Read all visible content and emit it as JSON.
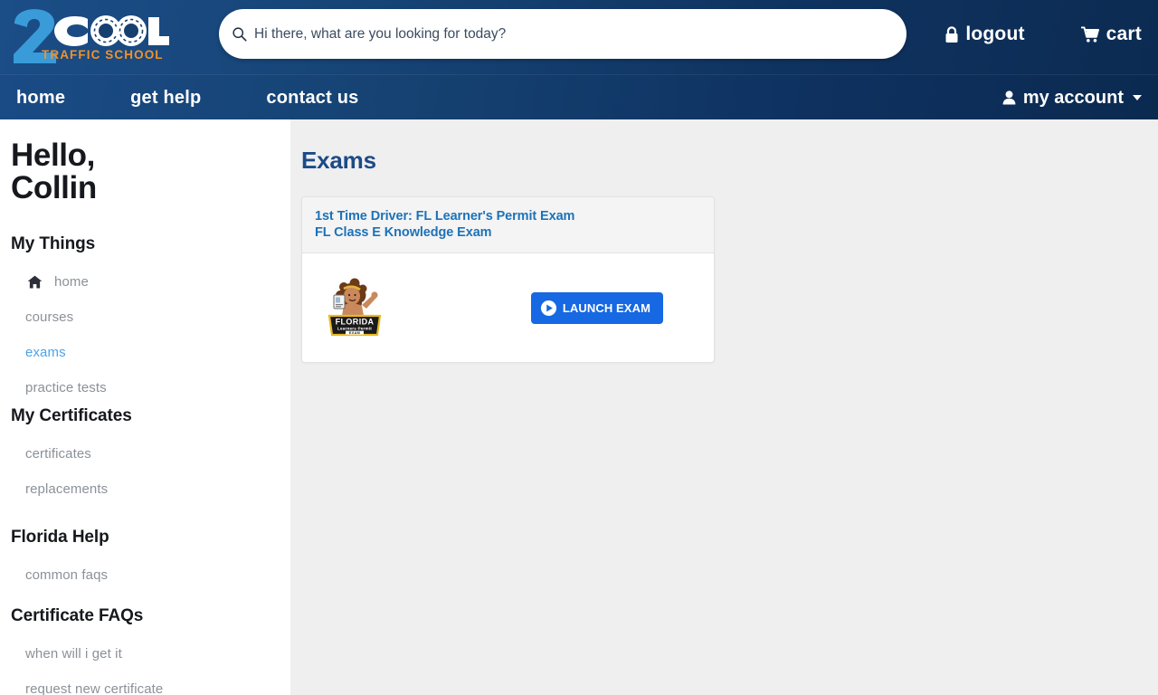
{
  "brand": {
    "logo_digit": "2",
    "logo_word": "COOL",
    "logo_tagline": "TRAFFIC SCHOOL",
    "blue": "#3a9bd9",
    "orange": "#f0922b",
    "navy": "#103360"
  },
  "header": {
    "search": {
      "placeholder": "Hi there, what are you looking for today?",
      "value": "",
      "icon": "search-icon"
    },
    "links": [
      {
        "label": "logout",
        "icon": "lock-icon"
      },
      {
        "label": "cart",
        "icon": "shopping-cart-icon"
      }
    ]
  },
  "nav": {
    "items": [
      {
        "label": "home"
      },
      {
        "label": "get help"
      },
      {
        "label": "contact us"
      }
    ],
    "account": {
      "label": "my account",
      "icon": "user-icon",
      "caret": "chevron-down-icon"
    }
  },
  "sidebar": {
    "greeting_line1": "Hello,",
    "greeting_line2": "Collin",
    "sections": [
      {
        "title": "My Things",
        "items": [
          {
            "label": "home",
            "icon": "house-icon",
            "active": false
          },
          {
            "label": "courses",
            "icon": "",
            "active": false
          },
          {
            "label": "exams",
            "icon": "",
            "active": true
          },
          {
            "label": "practice tests",
            "icon": "",
            "active": false
          }
        ]
      },
      {
        "title": "My Certificates",
        "items": [
          {
            "label": "certificates",
            "icon": "",
            "active": false
          },
          {
            "label": "replacements",
            "icon": "",
            "active": false
          }
        ]
      },
      {
        "title": "Florida Help",
        "items": [
          {
            "label": "common faqs",
            "icon": "",
            "active": false
          }
        ]
      },
      {
        "title": "Certificate FAQs",
        "items": [
          {
            "label": "when will i get it",
            "icon": "",
            "active": false
          },
          {
            "label": "request new certificate",
            "icon": "",
            "active": false
          }
        ]
      }
    ]
  },
  "main": {
    "title": "Exams",
    "cards": [
      {
        "heading_line1": "1st Time Driver: FL Learner's Permit Exam",
        "heading_line2": "FL Class E Knowledge Exam",
        "thumbnail": {
          "name": "florida-learners-permit-exam-badge",
          "badge_line1": "FLORIDA",
          "badge_line2": "Learners Permit",
          "badge_line3": "EXAM"
        },
        "button": {
          "label": "LAUNCH EXAM",
          "icon": "play-circle-icon",
          "color": "#1668e3"
        }
      }
    ]
  }
}
